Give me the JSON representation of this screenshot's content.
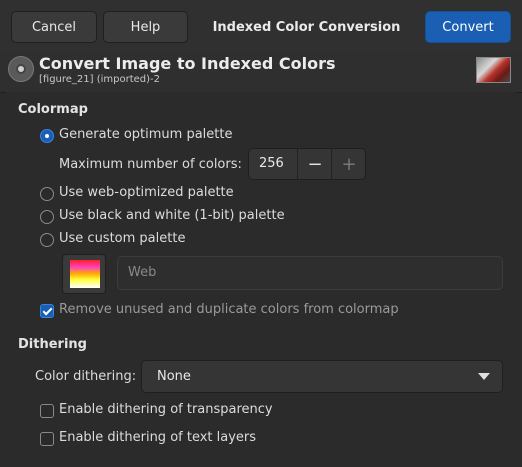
{
  "header": {
    "cancel_label": "Cancel",
    "help_label": "Help",
    "title": "Indexed Color Conversion",
    "convert_label": "Convert"
  },
  "subheader": {
    "title": "Convert Image to Indexed Colors",
    "file": "[figure_21] (imported)-2"
  },
  "colormap": {
    "heading": "Colormap",
    "options": [
      {
        "label": "Generate optimum palette",
        "selected": true
      },
      {
        "label": "Use web-optimized palette",
        "selected": false
      },
      {
        "label": "Use black and white (1-bit) palette",
        "selected": false
      },
      {
        "label": "Use custom palette",
        "selected": false
      }
    ],
    "max_colors_label": "Maximum number of colors:",
    "max_colors_value": "256",
    "minus": "−",
    "plus": "+",
    "custom_palette_name": "Web",
    "remove_unused_label": "Remove unused and duplicate colors from colormap",
    "remove_unused_checked": true
  },
  "dithering": {
    "heading": "Dithering",
    "color_dithering_label": "Color dithering:",
    "color_dithering_value": "None",
    "transparency_label": "Enable dithering of transparency",
    "transparency_checked": false,
    "text_layers_label": "Enable dithering of text layers",
    "text_layers_checked": false
  },
  "colors": {
    "accent": "#1a5fb4",
    "background": "#2b2b2b"
  }
}
